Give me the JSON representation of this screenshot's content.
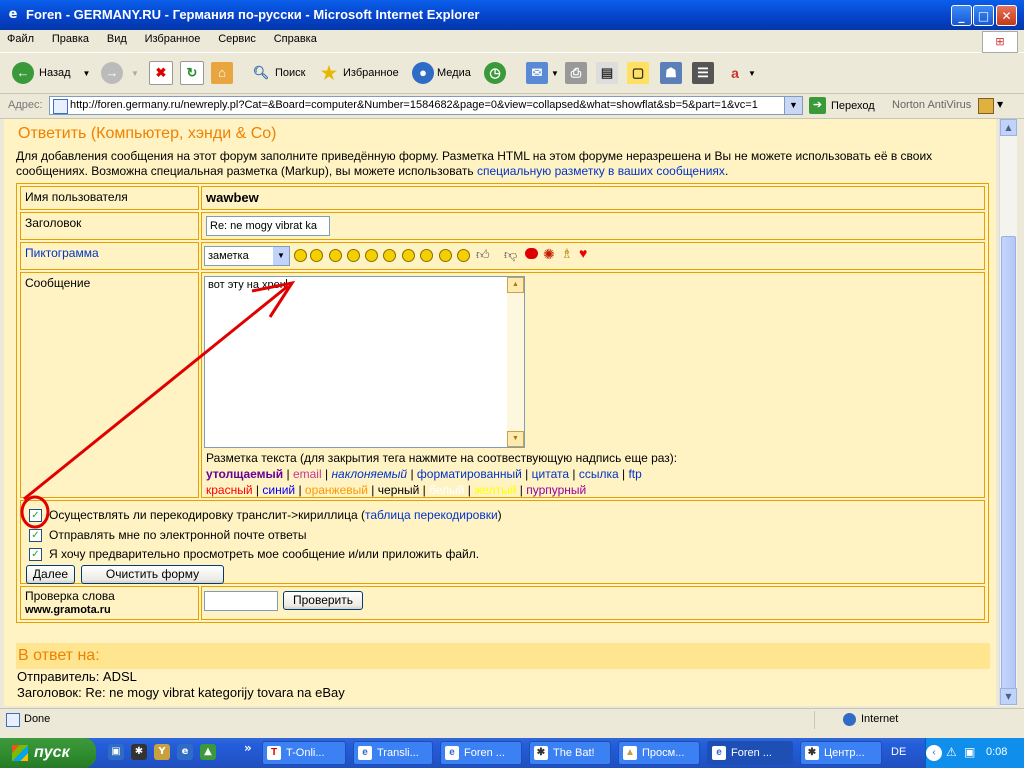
{
  "window": {
    "title": "Foren - GERMANY.RU - Германия по-русски - Microsoft Internet Explorer",
    "minimize": "_",
    "maximize": "□",
    "close": "✕"
  },
  "menu": [
    "Файл",
    "Правка",
    "Вид",
    "Избранное",
    "Сервис",
    "Справка"
  ],
  "toolbar": {
    "back": "Назад",
    "search": "Поиск",
    "favorites": "Избранное",
    "media": "Медиа"
  },
  "address": {
    "label": "Адрес:",
    "url": "http://foren.germany.ru/newreply.pl?Cat=&Board=computer&Number=1584682&page=0&view=collapsed&what=showflat&sb=5&part=1&vc=1",
    "go": "Переход",
    "norton": "Norton AntiVirus"
  },
  "page": {
    "title": "Ответить (Компьютер, хэнди & Co)",
    "intro_text": "Для добавления сообщения на этот форум заполните приведённую форму. Разметка HTML на этом форуме неразрешена и Вы не можете использовать её в своих сообщениях. Возможна специальная разметка (Markup), вы можете использовать",
    "intro_link": "специальную разметку в ваших сообщениях",
    "intro_end": ".",
    "form": {
      "username_label": "Имя пользователя",
      "username_value": "wawbew",
      "subject_label": "Заголовок",
      "subject_value": "Re: ne mogy vibrat ka",
      "icon_label": "Пиктограмма",
      "icon_select": "заметка",
      "message_label": "Сообщение",
      "message_value": "вот эту на хрен",
      "markup_hint": "Разметка текста (для закрытия тега нажмите на соотвествующую надпись еще раз):",
      "markup_tags": [
        {
          "label": "утолщаемый",
          "color": "#660099"
        },
        {
          "label": "email",
          "color": "#CC3399"
        },
        {
          "label": "наклоняемый",
          "color": "#0033CC"
        },
        {
          "label": "форматированный",
          "color": "#0033CC"
        },
        {
          "label": "цитата",
          "color": "#0033CC"
        },
        {
          "label": "ссылка",
          "color": "#0033CC"
        },
        {
          "label": "ftp",
          "color": "#0033CC"
        }
      ],
      "color_tags": [
        {
          "label": "красный",
          "color": "#FF0000"
        },
        {
          "label": "синий",
          "color": "#0000FF"
        },
        {
          "label": "оранжевый",
          "color": "#FF9900"
        },
        {
          "label": "черный",
          "color": "#000000"
        },
        {
          "label": "белый",
          "color": "#FFFFFF"
        },
        {
          "label": "желтый",
          "color": "#FFFF00"
        },
        {
          "label": "пурпурный",
          "color": "#990099"
        }
      ],
      "translit_label": "Осуществлять ли перекодировку транслит->кириллица (",
      "translit_link": "таблица перекодировки",
      "translit_end": ")",
      "email_notify_label": "Отправлять мне по электронной почте ответы",
      "preview_label": "Я хочу предварительно просмотреть мое сообщение и/или приложить файл.",
      "next_button": "Далее",
      "clear_button": "Очистить форму",
      "spell_label": "Проверка слова",
      "spell_site": "www.gramota.ru",
      "check_button": "Проверить"
    },
    "reply_section_title": "В ответ на:",
    "sender_line": "Отправитель: ADSL",
    "subject_line": "Заголовок: Re: ne mogy vibrat kategorijy tovara na eBay"
  },
  "status": {
    "text": "Done",
    "zone": "Internet"
  },
  "taskbar": {
    "start": "пуск",
    "tasks": [
      {
        "label": "T-Onli...",
        "active": false
      },
      {
        "label": "Transli...",
        "active": false
      },
      {
        "label": "Foren ...",
        "active": false
      },
      {
        "label": "The Bat!",
        "active": false
      },
      {
        "label": "Просм...",
        "active": false
      },
      {
        "label": "Foren ...",
        "active": true
      },
      {
        "label": "Центр...",
        "active": false
      }
    ],
    "lang": "DE",
    "clock": "0:08"
  }
}
